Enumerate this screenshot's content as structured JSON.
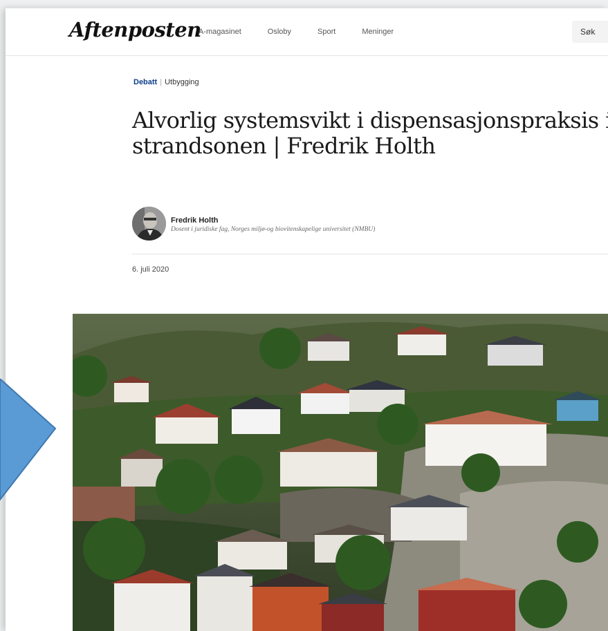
{
  "header": {
    "logo": "Aftenposten",
    "nav": [
      "A-magasinet",
      "Osloby",
      "Sport",
      "Meninger"
    ],
    "search_label": "Søk"
  },
  "article": {
    "section": "Debatt",
    "topic": "Utbygging",
    "title": "Alvorlig systemsvikt i dispensasjonspraksis i strandsonen | Fredrik Holth",
    "author": {
      "name": "Fredrik Holth",
      "role": "Dosent i juridiske fag, Norges miljø-og biovitenskapelige universitet (NMBU)"
    },
    "date": "6. juli 2020"
  },
  "colors": {
    "section_link": "#0b3e8a",
    "arrow": "#5b9bd5"
  }
}
